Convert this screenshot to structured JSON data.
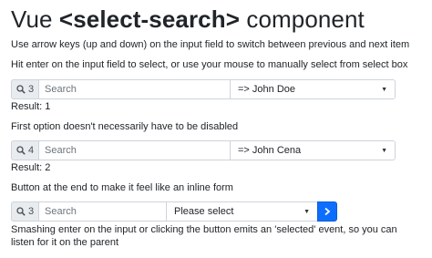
{
  "title": {
    "prefix": "Vue ",
    "tag": "<select-search>",
    "suffix": " component"
  },
  "intro": {
    "line1": "Use arrow keys (up and down) on the input field to switch between previous and next item",
    "line2": "Hit enter on the input field to select, or use your mouse to manually select from select box"
  },
  "example1": {
    "count": "3",
    "search_placeholder": "Search",
    "selected": "=> John Doe",
    "result": "Result: 1"
  },
  "note2": "First option doesn't necessarily have to be disabled",
  "example2": {
    "count": "4",
    "search_placeholder": "Search",
    "selected": "=> John Cena",
    "result": "Result: 2"
  },
  "note3": "Button at the end to make it feel like an inline form",
  "example3": {
    "count": "3",
    "search_placeholder": "Search",
    "selected": "Please select",
    "footer": "Smashing enter on the input or clicking the button emits an 'selected' event, so you can listen for it on the parent"
  },
  "colors": {
    "accent": "#0d6efd",
    "addon_bg": "#e9ecef",
    "border": "#ced4da"
  },
  "icons": {
    "search": "search-icon",
    "caret": "caret-down-icon",
    "submit": "chevron-right-icon"
  }
}
